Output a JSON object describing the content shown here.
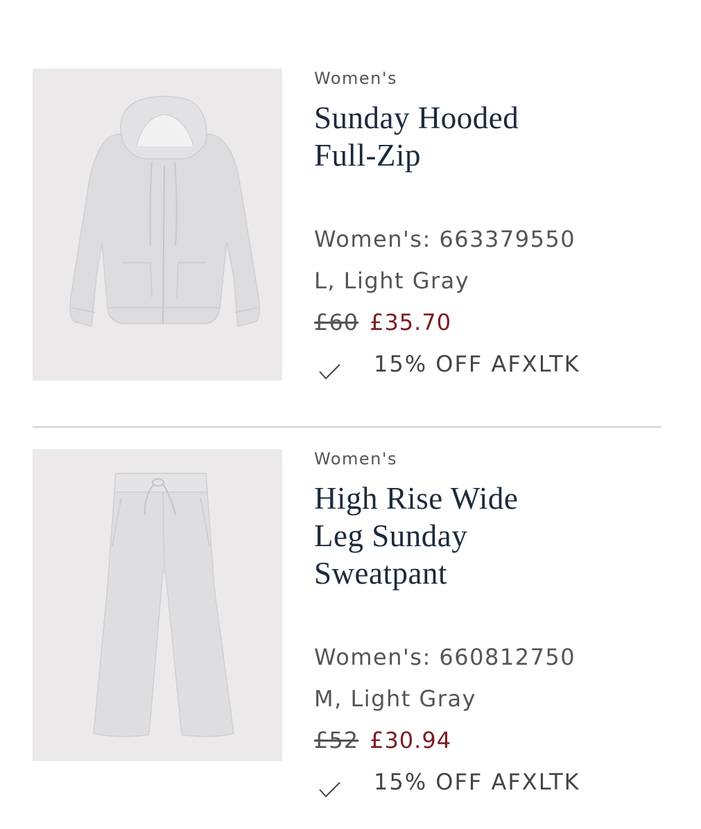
{
  "items": [
    {
      "category": "Women's",
      "title_line1": "Sunday Hooded",
      "title_line2": "Full-Zip",
      "title_line3": "",
      "sku": "Women's: 663379550",
      "variant": "L, Light Gray",
      "original_price": "£60",
      "sale_price": "£35.70",
      "promo": "15% OFF AFXLTK",
      "image_icon": "hoodie-image"
    },
    {
      "category": "Women's",
      "title_line1": "High Rise Wide",
      "title_line2": "Leg Sunday",
      "title_line3": "Sweatpant",
      "sku": "Women's: 660812750",
      "variant": "M, Light Gray",
      "original_price": "£52",
      "sale_price": "£30.94",
      "promo": "15% OFF AFXLTK",
      "image_icon": "sweatpant-image"
    }
  ],
  "colors": {
    "title": "#1c2a3c",
    "sale_price": "#7d1a22",
    "image_bg": "#ebe9ea",
    "divider": "#cfcfcf"
  }
}
